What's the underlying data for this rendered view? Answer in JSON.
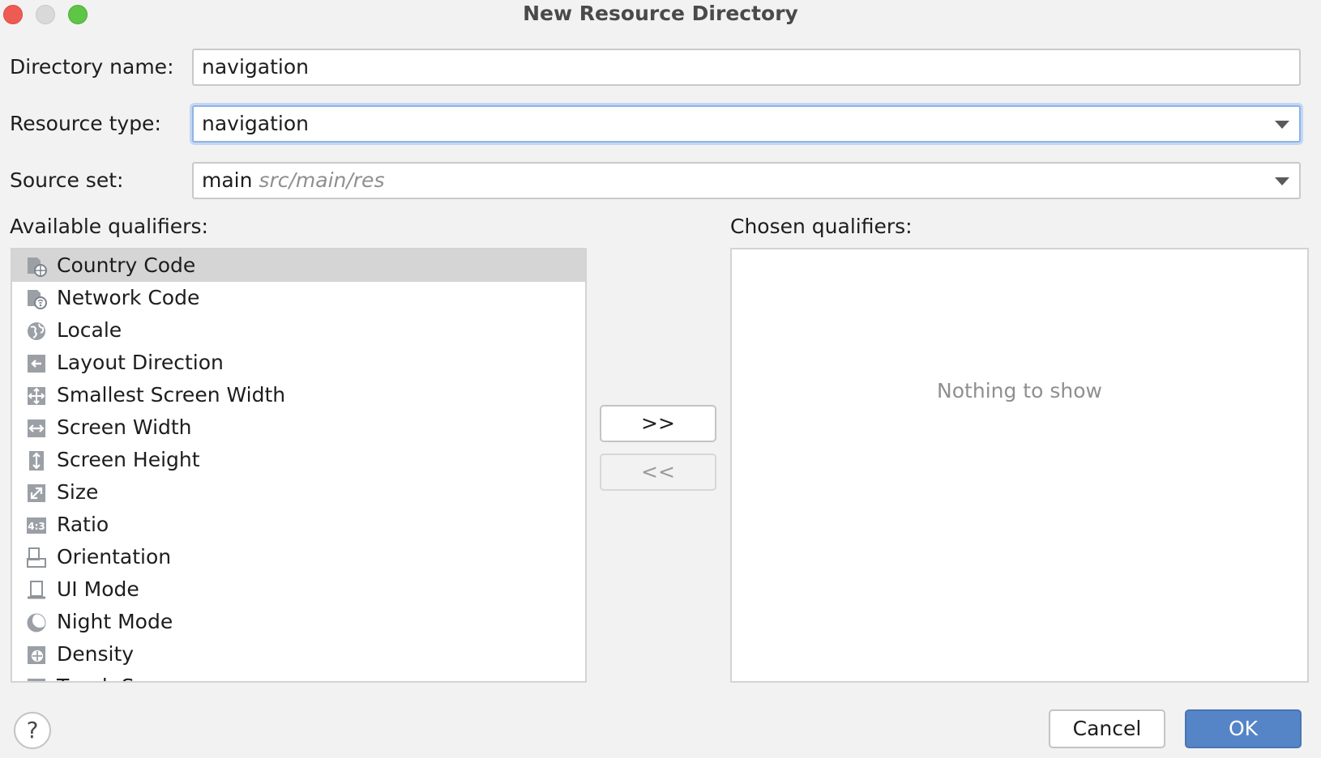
{
  "window": {
    "title": "New Resource Directory"
  },
  "form": {
    "directory_name": {
      "label": "Directory name:",
      "value": "navigation"
    },
    "resource_type": {
      "label": "Resource type:",
      "value": "navigation"
    },
    "source_set": {
      "label": "Source set:",
      "value": "main",
      "path": "src/main/res"
    }
  },
  "available": {
    "label": "Available qualifiers:",
    "items": [
      {
        "label": "Country Code",
        "icon": "country-code-icon",
        "selected": true
      },
      {
        "label": "Network Code",
        "icon": "network-code-icon"
      },
      {
        "label": "Locale",
        "icon": "globe-icon"
      },
      {
        "label": "Layout Direction",
        "icon": "layout-direction-icon"
      },
      {
        "label": "Smallest Screen Width",
        "icon": "smallest-screen-width-icon"
      },
      {
        "label": "Screen Width",
        "icon": "screen-width-icon"
      },
      {
        "label": "Screen Height",
        "icon": "screen-height-icon"
      },
      {
        "label": "Size",
        "icon": "size-icon"
      },
      {
        "label": "Ratio",
        "icon": "ratio-icon"
      },
      {
        "label": "Orientation",
        "icon": "orientation-icon"
      },
      {
        "label": "UI Mode",
        "icon": "ui-mode-icon"
      },
      {
        "label": "Night Mode",
        "icon": "night-mode-icon"
      },
      {
        "label": "Density",
        "icon": "density-icon"
      },
      {
        "label": "Touch Screen",
        "icon": "touch-screen-icon"
      }
    ]
  },
  "chosen": {
    "label": "Chosen qualifiers:",
    "empty_text": "Nothing to show"
  },
  "buttons": {
    "add": ">>",
    "remove": "<<",
    "cancel": "Cancel",
    "ok": "OK",
    "help": "?"
  },
  "colors": {
    "accent": "#5585c7",
    "focus_ring": "#8fb4e6",
    "selection": "#d5d5d5"
  }
}
